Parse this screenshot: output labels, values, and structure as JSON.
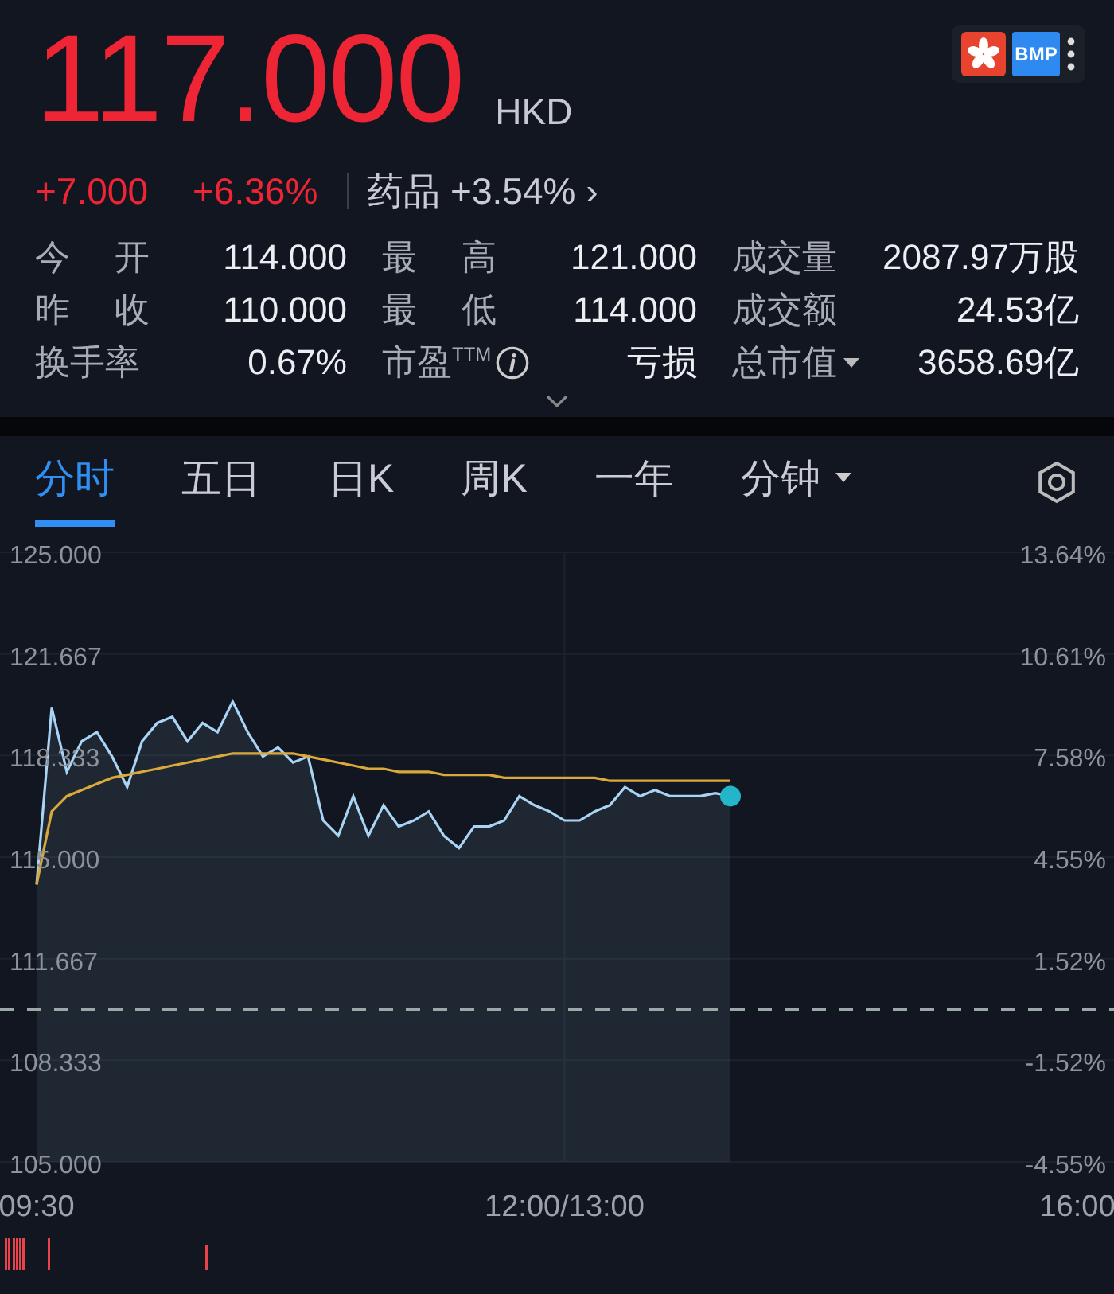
{
  "quote": {
    "price": "117.000",
    "currency": "HKD",
    "change": "+7.000",
    "change_pct": "+6.36%",
    "sector": "药品",
    "sector_change": "+3.54%",
    "sector_arrow": "›",
    "badge": "BMP"
  },
  "stats": [
    {
      "label": "今开",
      "value": "114.000"
    },
    {
      "label": "最高",
      "value": "121.000"
    },
    {
      "label": "成交量",
      "value": "2087.97万股"
    },
    {
      "label": "昨收",
      "value": "110.000"
    },
    {
      "label": "最低",
      "value": "114.000"
    },
    {
      "label": "成交额",
      "value": "24.53亿"
    },
    {
      "label": "换手率",
      "value": "0.67%"
    },
    {
      "label": "市盈$^{TTM}$",
      "value": "亏损"
    },
    {
      "label": "总市值",
      "value": "3658.69亿"
    }
  ],
  "tabs": [
    {
      "label": "分时",
      "selected": true
    },
    {
      "label": "五日",
      "selected": false
    },
    {
      "label": "日K",
      "selected": false
    },
    {
      "label": "周K",
      "selected": false
    },
    {
      "label": "一年",
      "selected": false
    },
    {
      "label": "分钟",
      "selected": false
    }
  ],
  "chart": {
    "percent_labels": [
      "13.64%",
      "10.61%",
      "7.58%",
      "4.55%",
      "1.52%",
      "-1.52%",
      "-4.55%"
    ],
    "chart_data": {
      "type": "area",
      "ylim": [
        105,
        125
      ],
      "categories": [
        "09:30",
        null,
        null,
        null,
        null,
        null,
        null,
        null,
        null,
        null,
        null,
        null,
        null,
        null,
        null,
        null,
        null,
        null,
        null,
        null,
        null,
        null,
        null,
        null,
        null,
        null,
        null,
        null,
        null,
        null,
        null,
        null,
        null,
        null,
        null,
        "12:00/13:00",
        null,
        null,
        null,
        null,
        null,
        null,
        null,
        null,
        null,
        null,
        null,
        null,
        null,
        null,
        null,
        null,
        null,
        null,
        null,
        null,
        null,
        null,
        null,
        null,
        null,
        null,
        null,
        null,
        null,
        null,
        null,
        null,
        null,
        "16:00"
      ],
      "yticks": [
        {
          "value": 125,
          "label": "125.000"
        },
        {
          "value": 121.667,
          "label": "121.667"
        },
        {
          "value": 118.333,
          "label": "118.333"
        },
        {
          "value": 115,
          "label": "115.000"
        },
        {
          "value": 111.667,
          "label": "111.667"
        },
        {
          "value": 108.333,
          "label": "108.333"
        },
        {
          "value": 105,
          "label": "105.000"
        }
      ],
      "grid": true,
      "ref_lines": [
        {
          "axis": "y",
          "value": 110
        }
      ],
      "series": [
        {
          "color": "#a9d4f5",
          "values": [
            114.1,
            119.9,
            117.8,
            118.8,
            119.1,
            118.3,
            117.3,
            118.8,
            119.4,
            119.6,
            118.8,
            119.4,
            119.1,
            120.1,
            119.1,
            118.3,
            118.6,
            118.1,
            118.3,
            116.2,
            115.7,
            117.0,
            115.7,
            116.7,
            116.0,
            116.2,
            116.5,
            115.7,
            115.3,
            116.0,
            116.0,
            116.2,
            117.0,
            116.7,
            116.5,
            116.2,
            116.2,
            116.5,
            116.7,
            117.3,
            117.0,
            117.2,
            117.0,
            117.0,
            117.0,
            117.1,
            117.0,
            null,
            null,
            null,
            null,
            null,
            null,
            null,
            null,
            null,
            null,
            null,
            null,
            null,
            null,
            null,
            null,
            null,
            null,
            null,
            null,
            null,
            null,
            null
          ]
        },
        {
          "type": "line",
          "color": "#d9a93c",
          "values": [
            114.1,
            116.5,
            117.0,
            117.2,
            117.4,
            117.6,
            117.7,
            117.8,
            117.9,
            118.0,
            118.1,
            118.2,
            118.3,
            118.4,
            118.4,
            118.4,
            118.4,
            118.4,
            118.3,
            118.2,
            118.1,
            118.0,
            117.9,
            117.9,
            117.8,
            117.8,
            117.8,
            117.7,
            117.7,
            117.7,
            117.7,
            117.6,
            117.6,
            117.6,
            117.6,
            117.6,
            117.6,
            117.6,
            117.5,
            117.5,
            117.5,
            117.5,
            117.5,
            117.5,
            117.5,
            117.5,
            117.5,
            null,
            null,
            null,
            null,
            null,
            null,
            null,
            null,
            null,
            null,
            null,
            null,
            null,
            null,
            null,
            null,
            null,
            null,
            null,
            null,
            null,
            null,
            null
          ]
        }
      ]
    }
  }
}
